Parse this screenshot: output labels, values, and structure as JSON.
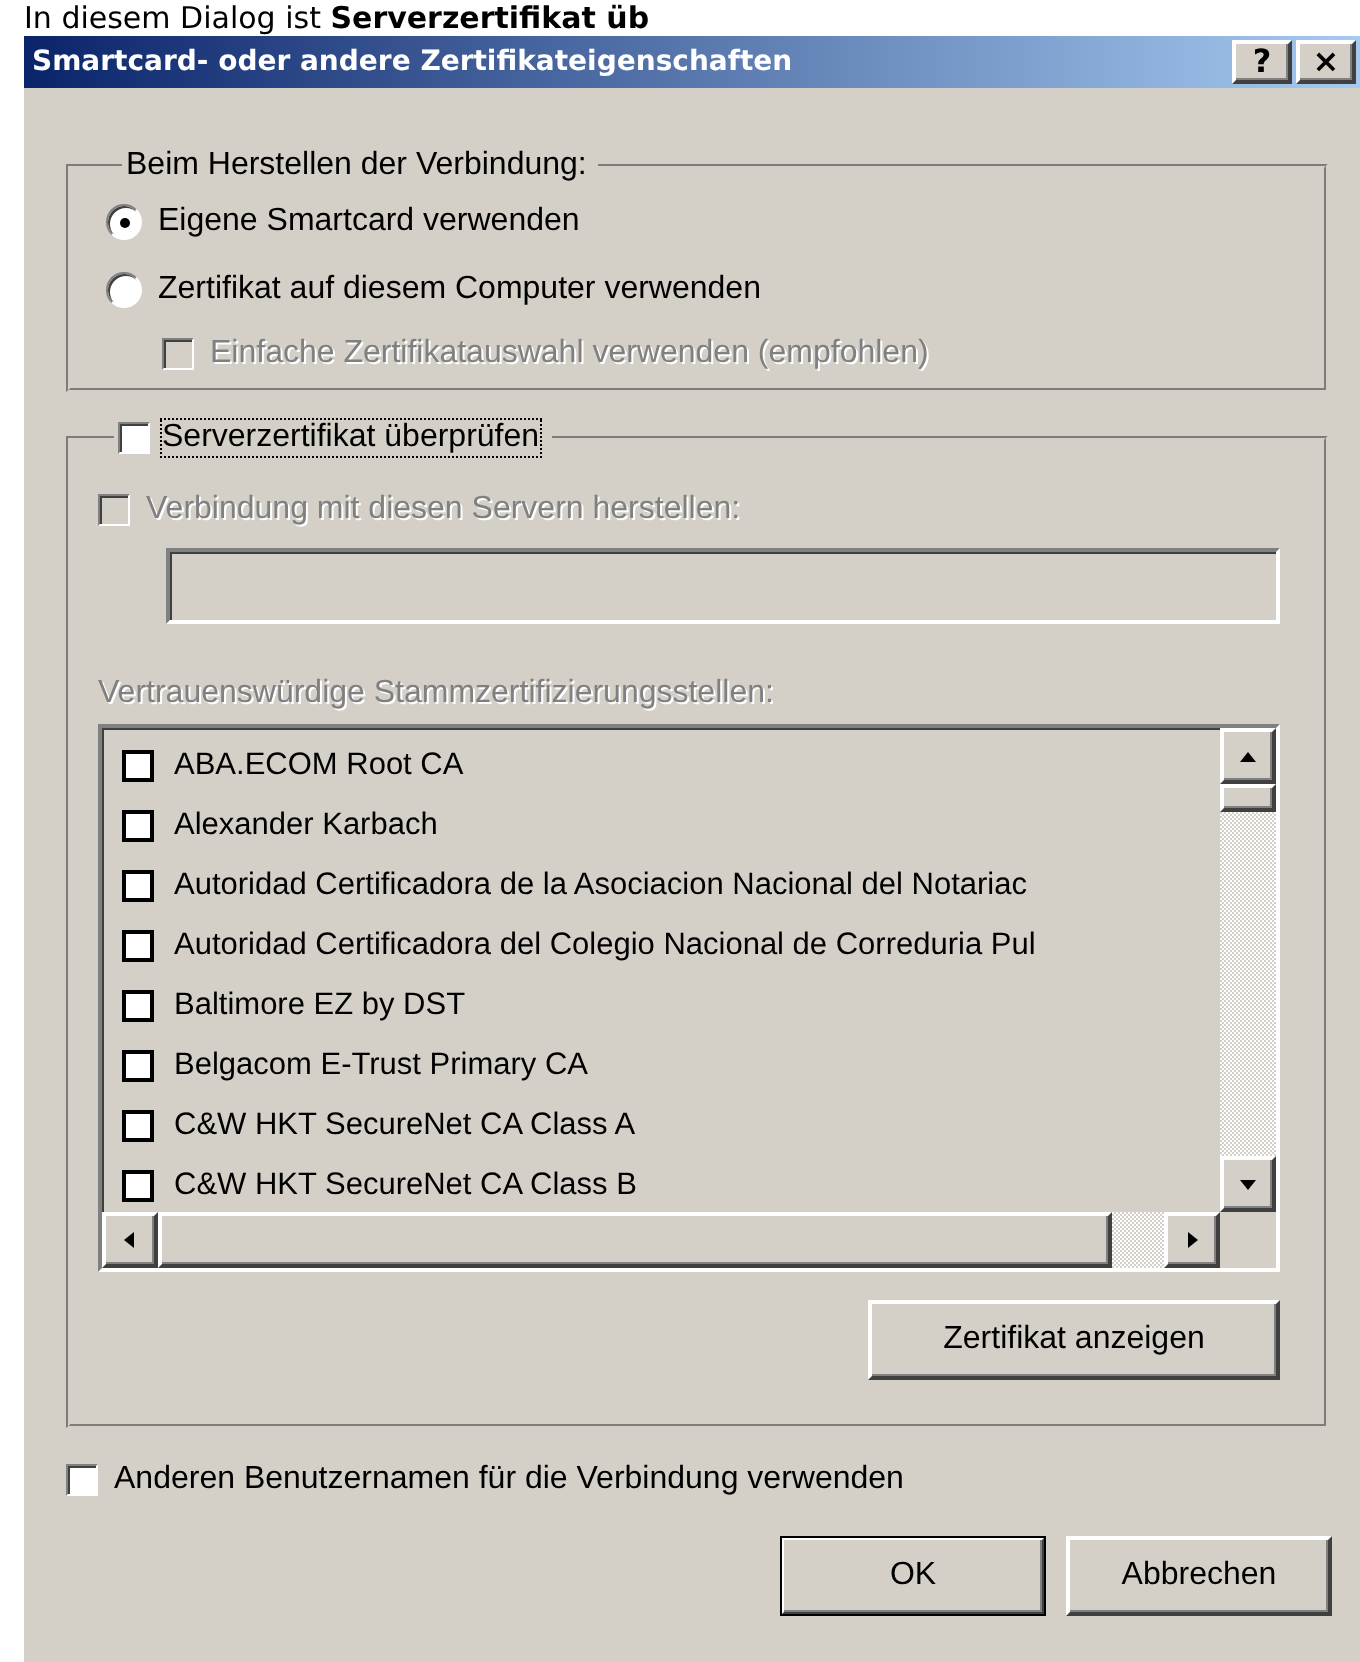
{
  "header_text": "In diesem Dialog ist **Serverzertifikat üb**",
  "window": {
    "title": "Smartcard- oder andere Zertifikateigenschaften",
    "title_buttons": [
      "?",
      "×"
    ]
  },
  "connection_group": {
    "legend": "Beim Herstellen der Verbindung:",
    "options": [
      {
        "kind": "radio",
        "label": "Eigene Smartcard verwenden",
        "selected": true,
        "disabled": false
      },
      {
        "kind": "radio",
        "label": "Zertifikat auf diesem Computer verwenden",
        "selected": false,
        "disabled": false
      },
      {
        "kind": "checkbox",
        "label": "Einfache Zertifikatauswahl verwenden (empfohlen)",
        "checked": false,
        "disabled": true
      }
    ]
  },
  "server_group": {
    "legend": "Serverzertifikat überprüfen",
    "checked": false,
    "connect_servers": {
      "label": "Verbindung mit diesen Servern herstellen:",
      "checked": false,
      "disabled": true
    },
    "servers_field": {
      "disabled": true
    },
    "list_label": "Vertrauenswürdige Stammzertifizierungsstellen:",
    "list_items": [
      {
        "label": "ABA.ECOM Root CA",
        "checked": false
      },
      {
        "label": "Alexander Karbach",
        "checked": false
      },
      {
        "label": "Autoridad Certificadora de la Asociacion Nacional del Notariac",
        "checked": false
      },
      {
        "label": "Autoridad Certificadora del Colegio Nacional de Correduria Pul",
        "checked": false
      },
      {
        "label": "Baltimore EZ by DST",
        "checked": false
      },
      {
        "label": "Belgacom E-Trust Primary CA",
        "checked": false
      },
      {
        "label": "C&W HKT SecureNet CA Class A",
        "checked": false
      },
      {
        "label": "C&W HKT SecureNet CA Class B",
        "checked": false
      }
    ],
    "view_button": "Zertifikat anzeigen"
  },
  "other_user": {
    "label": "Anderen Benutzernamen für die Verbindung verwenden",
    "checked": false
  },
  "buttons": [
    {
      "label": "OK",
      "default": true
    },
    {
      "label": "Abbrechen",
      "default": false
    }
  ]
}
